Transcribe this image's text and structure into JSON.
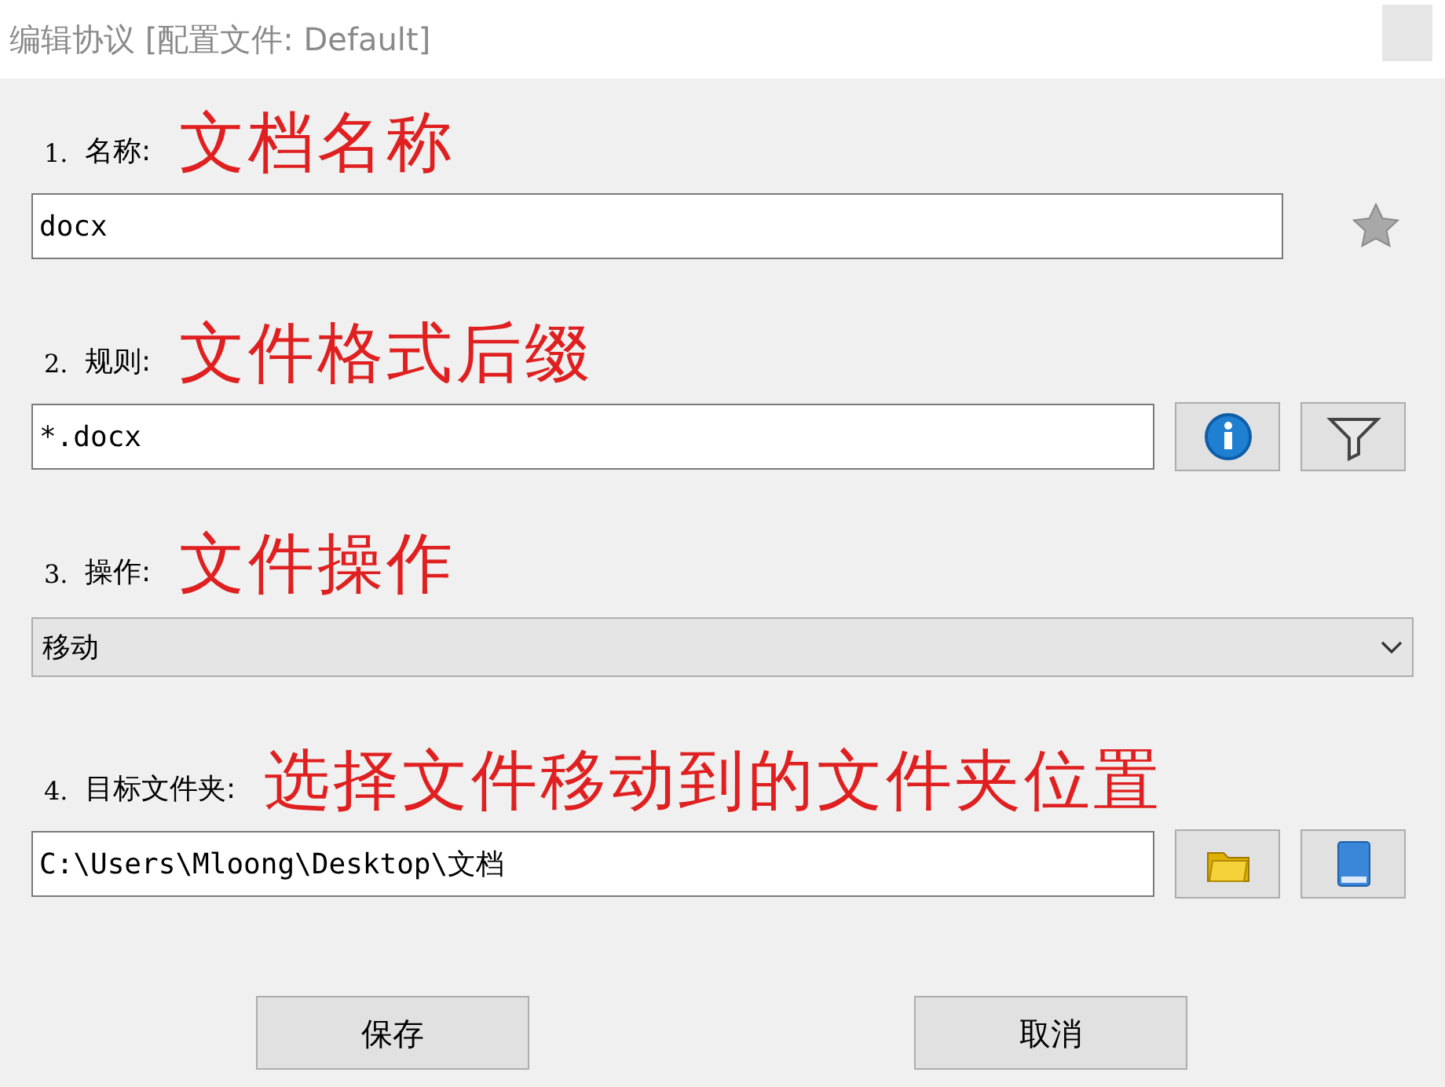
{
  "window": {
    "title": "编辑协议 [配置文件: Default]"
  },
  "sections": [
    {
      "kind": "text",
      "number": "1.",
      "label": "名称:",
      "annotation": "文档名称",
      "value": "docx",
      "buttons": [
        {
          "kind": "star"
        }
      ]
    },
    {
      "kind": "text",
      "number": "2.",
      "label": "规则:",
      "annotation": "文件格式后缀",
      "value": "*.docx",
      "buttons": [
        {
          "kind": "info"
        },
        {
          "kind": "filter"
        }
      ]
    },
    {
      "kind": "select",
      "number": "3.",
      "label": "操作:",
      "annotation": "文件操作",
      "value": "移动"
    },
    {
      "kind": "text",
      "number": "4.",
      "label": "目标文件夹:",
      "annotation": "选择文件移动到的文件夹位置",
      "value": "C:\\Users\\Mloong\\Desktop\\文档",
      "buttons": [
        {
          "kind": "folder"
        },
        {
          "kind": "book"
        }
      ]
    }
  ],
  "buttons": [
    "保存",
    "取消"
  ]
}
